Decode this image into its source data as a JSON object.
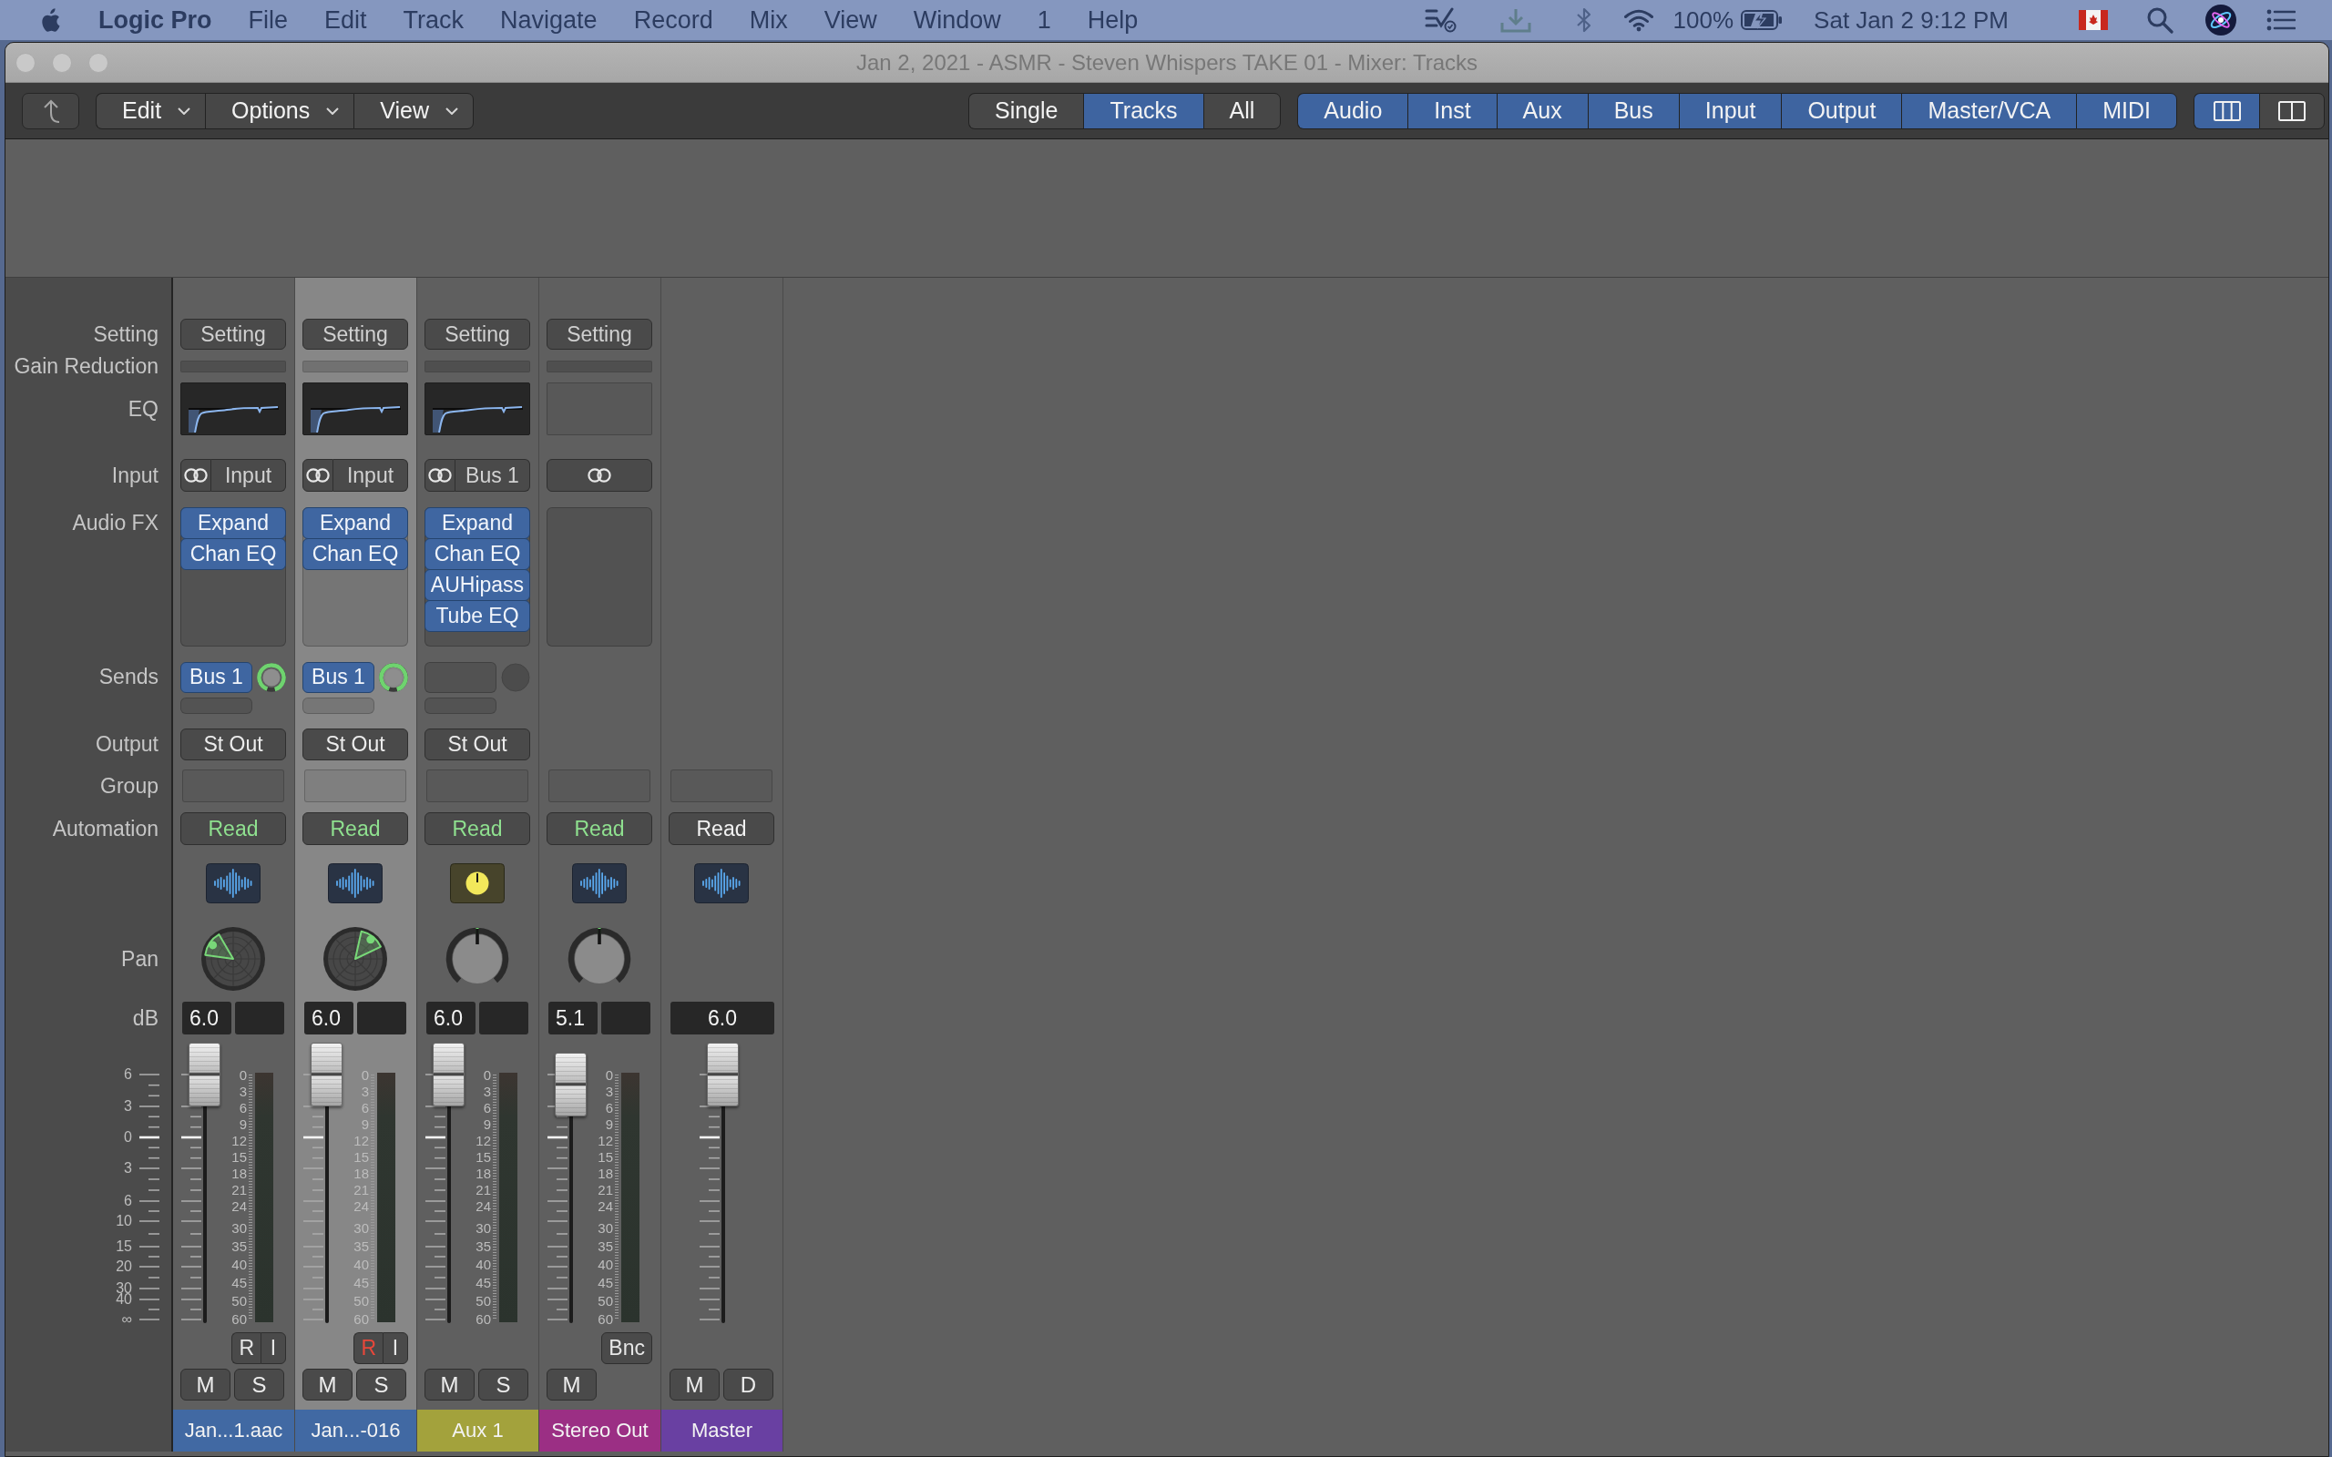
{
  "menu_bar": {
    "app": "Logic Pro",
    "items": [
      "File",
      "Edit",
      "Track",
      "Navigate",
      "Record",
      "Mix",
      "View",
      "Window",
      "1",
      "Help"
    ],
    "battery": "100%",
    "clock": "Sat Jan 2 9:12 PM"
  },
  "window": {
    "title": "Jan 2, 2021 - ASMR - Steven Whispers TAKE 01 - Mixer: Tracks"
  },
  "toolbar": {
    "menus": [
      "Edit",
      "Options",
      "View"
    ],
    "view_modes": [
      {
        "label": "Single",
        "selected": false
      },
      {
        "label": "Tracks",
        "selected": true
      },
      {
        "label": "All",
        "selected": false
      }
    ],
    "filters": [
      {
        "label": "Audio",
        "selected": true
      },
      {
        "label": "Inst",
        "selected": true
      },
      {
        "label": "Aux",
        "selected": true
      },
      {
        "label": "Bus",
        "selected": true
      },
      {
        "label": "Input",
        "selected": true
      },
      {
        "label": "Output",
        "selected": true
      },
      {
        "label": "Master/VCA",
        "selected": true
      },
      {
        "label": "MIDI",
        "selected": true
      }
    ],
    "layouts": [
      {
        "kind": "wide",
        "selected": true
      },
      {
        "kind": "narrow",
        "selected": false
      }
    ]
  },
  "row_labels": {
    "setting": "Setting",
    "gain_reduction": "Gain Reduction",
    "eq": "EQ",
    "input": "Input",
    "audio_fx": "Audio FX",
    "sends": "Sends",
    "output": "Output",
    "group": "Group",
    "automation": "Automation",
    "pan": "Pan",
    "db": "dB"
  },
  "fader_scale": [
    "6",
    "3",
    "0",
    "3",
    "6",
    "10",
    "15",
    "20",
    "30",
    "40",
    "∞"
  ],
  "channels": [
    {
      "kind": "audio",
      "selected": false,
      "setting": "Setting",
      "eq": {
        "curve": true
      },
      "input": "Input",
      "audio_fx": [
        "Expand",
        "Chan EQ"
      ],
      "sends": [
        {
          "label": "Bus 1",
          "level": 0.9
        }
      ],
      "output": "St Out",
      "automation": {
        "label": "Read",
        "active": true
      },
      "pan": {
        "kind": "binaural",
        "level": 0.18
      },
      "volume": "6.0",
      "fader": {
        "level": 1
      },
      "meter_scale": [
        "0",
        "3",
        "6",
        "9",
        "12",
        "15",
        "18",
        "21",
        "24",
        "30",
        "35",
        "40",
        "45",
        "50",
        "60"
      ],
      "track_buttons": [
        {
          "label": "R",
          "on": false
        },
        {
          "label": "I",
          "on": false
        }
      ],
      "buttons": [
        "M",
        "S"
      ],
      "name": "Jan...1.aac",
      "color": "#4169a3"
    },
    {
      "kind": "audio",
      "selected": true,
      "setting": "Setting",
      "eq": {
        "curve": true
      },
      "input": "Input",
      "audio_fx": [
        "Expand",
        "Chan EQ"
      ],
      "sends": [
        {
          "label": "Bus 1",
          "level": 0.9
        }
      ],
      "output": "St Out",
      "automation": {
        "label": "Read",
        "active": true
      },
      "pan": {
        "kind": "binaural",
        "level": 0.74
      },
      "volume": "6.0",
      "fader": {
        "level": 1
      },
      "meter_scale": [
        "0",
        "3",
        "6",
        "9",
        "12",
        "15",
        "18",
        "21",
        "24",
        "30",
        "35",
        "40",
        "45",
        "50",
        "60"
      ],
      "track_buttons": [
        {
          "label": "R",
          "on": true
        },
        {
          "label": "I",
          "on": false
        }
      ],
      "buttons": [
        "M",
        "S"
      ],
      "name": "Jan...-016",
      "color": "#4169a3"
    },
    {
      "kind": "aux",
      "selected": false,
      "setting": "Setting",
      "eq": {
        "curve": true
      },
      "input": "Bus 1",
      "audio_fx": [
        "Expand",
        "Chan EQ",
        "AUHipass",
        "Tube EQ"
      ],
      "output": "St Out",
      "automation": {
        "label": "Read",
        "active": true
      },
      "pan": {
        "kind": "knob",
        "level": 0.5
      },
      "volume": "6.0",
      "fader": {
        "level": 1
      },
      "meter_scale": [
        "0",
        "3",
        "6",
        "9",
        "12",
        "15",
        "18",
        "21",
        "24",
        "30",
        "35",
        "40",
        "45",
        "50",
        "60"
      ],
      "buttons": [
        "M",
        "S"
      ],
      "name": "Aux 1",
      "color": "#a3a23c"
    },
    {
      "kind": "output",
      "selected": false,
      "setting": "Setting",
      "eq": {
        "curve": false
      },
      "automation": {
        "label": "Read",
        "active": true
      },
      "pan": {
        "kind": "knob",
        "level": 0.5
      },
      "volume": "5.1",
      "fader": {
        "level": 0.96
      },
      "meter_scale": [
        "0",
        "3",
        "6",
        "9",
        "12",
        "15",
        "18",
        "21",
        "24",
        "30",
        "35",
        "40",
        "45",
        "50",
        "60"
      ],
      "track_buttons": [
        {
          "label": "Bnc",
          "on": false
        }
      ],
      "buttons": [
        "M"
      ],
      "name": "Stereo Out",
      "color": "#9b2f84"
    },
    {
      "kind": "master",
      "selected": false,
      "automation": {
        "label": "Read",
        "active": false
      },
      "volume": "6.0",
      "fader": {
        "level": 1
      },
      "buttons": [
        "M",
        "D"
      ],
      "name": "Master",
      "color": "#6940a2"
    }
  ]
}
